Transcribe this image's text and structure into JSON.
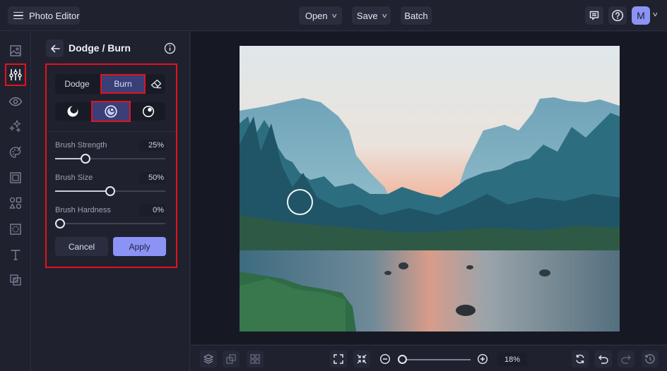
{
  "topbar": {
    "app_title": "Photo Editor",
    "open_label": "Open",
    "save_label": "Save",
    "batch_label": "Batch",
    "avatar_initial": "M",
    "icons": [
      "menu-icon",
      "comment-icon",
      "help-icon",
      "chevron-down-icon"
    ]
  },
  "sidebar": {
    "items": [
      {
        "name": "image",
        "icon": "image-icon",
        "active": false
      },
      {
        "name": "adjust",
        "icon": "sliders-icon",
        "active": true
      },
      {
        "name": "effects",
        "icon": "eye-icon",
        "active": false
      },
      {
        "name": "touch-up",
        "icon": "sparkle-icon",
        "active": false
      },
      {
        "name": "artsy",
        "icon": "palette-icon",
        "active": false
      },
      {
        "name": "frames",
        "icon": "frame-icon",
        "active": false
      },
      {
        "name": "graphics",
        "icon": "shapes-icon",
        "active": false
      },
      {
        "name": "textures",
        "icon": "texture-icon",
        "active": false
      },
      {
        "name": "text",
        "icon": "text-icon",
        "active": false
      },
      {
        "name": "overlays",
        "icon": "overlay-icon",
        "active": false
      }
    ]
  },
  "panel": {
    "title": "Dodge / Burn",
    "modes": {
      "dodge": "Dodge",
      "burn": "Burn",
      "selected": "Burn"
    },
    "range": {
      "options": [
        "shadows",
        "midtones",
        "highlights"
      ],
      "selected": "midtones"
    },
    "sliders": [
      {
        "label": "Brush Strength",
        "value_text": "25%",
        "value": 25
      },
      {
        "label": "Brush Size",
        "value_text": "50%",
        "value": 50
      },
      {
        "label": "Brush Hardness",
        "value_text": "0%",
        "value": 0
      }
    ],
    "cancel_label": "Cancel",
    "apply_label": "Apply"
  },
  "bottombar": {
    "zoom_text": "18%",
    "zoom_value": 0,
    "icons": [
      "layers-icon",
      "duplicate-icon",
      "grid-icon",
      "fit-screen-icon",
      "shrink-icon",
      "zoom-out-icon",
      "zoom-in-icon",
      "reset-icon",
      "undo-icon",
      "redo-icon",
      "history-icon"
    ]
  },
  "colors": {
    "accent": "#8b94f5",
    "highlight": "#e3121b",
    "selected_segment": "#3b3f78",
    "background": "#1f212f"
  }
}
